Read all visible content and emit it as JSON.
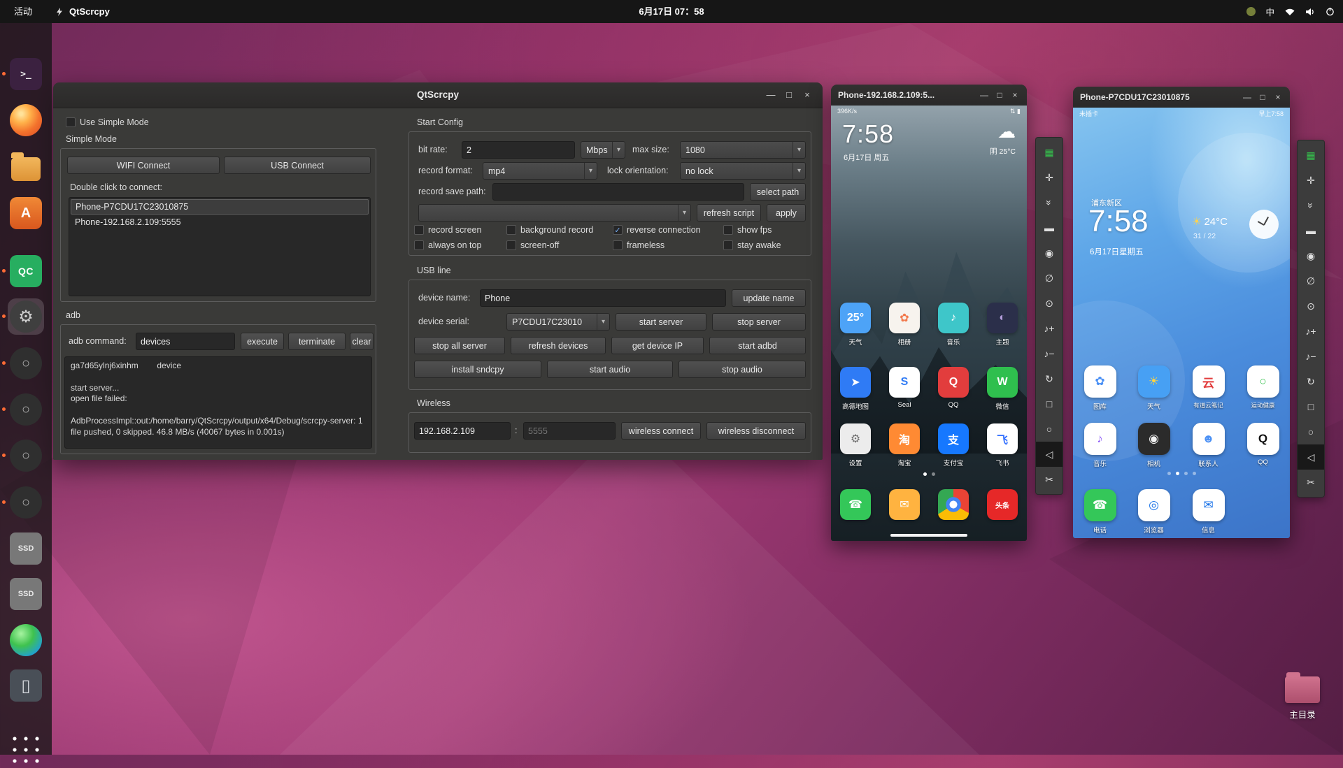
{
  "icons": {
    "chevron_down": "▾",
    "check": "✓"
  },
  "topbar": {
    "activities": "活动",
    "app_name": "QtScrcpy",
    "clock": "6月17日 07：58",
    "input_method": "中"
  },
  "dock": {
    "items": [
      {
        "name": "terminal",
        "glyph": ">_"
      },
      {
        "name": "firefox",
        "glyph": ""
      },
      {
        "name": "files",
        "glyph": ""
      },
      {
        "name": "ubuntu-software",
        "glyph": "A"
      },
      {
        "name": "qt-creator",
        "glyph": "QC"
      },
      {
        "name": "settings",
        "glyph": "⚙"
      },
      {
        "name": "phone-device-1",
        "glyph": "○"
      },
      {
        "name": "phone-device-2",
        "glyph": "○"
      },
      {
        "name": "phone-device-3",
        "glyph": "○"
      },
      {
        "name": "phone-device-4",
        "glyph": "○"
      },
      {
        "name": "ssd-1",
        "glyph": "SSD"
      },
      {
        "name": "ssd-2",
        "glyph": "SSD"
      },
      {
        "name": "disk-analyzer",
        "glyph": ""
      },
      {
        "name": "tablet-device",
        "glyph": ""
      },
      {
        "name": "show-applications",
        "glyph": ""
      }
    ]
  },
  "window": {
    "title": "QtScrcpy",
    "controls": {
      "minimize": "—",
      "maximize": "□",
      "close": "×"
    },
    "left": {
      "use_simple_mode": "Use Simple Mode",
      "simple_mode_group": "Simple Mode",
      "wifi_connect": "WIFI Connect",
      "usb_connect": "USB Connect",
      "double_click_hint": "Double click to connect:",
      "devices": [
        "Phone-P7CDU17C23010875",
        "Phone-192.168.2.109:5555"
      ],
      "adb_group": "adb",
      "adb_command_label": "adb command:",
      "adb_command_value": "devices",
      "execute": "execute",
      "terminate": "terminate",
      "clear": "clear",
      "log": "ga7d65ylnj6xinhm        device\n\nstart server...\nopen file failed:\n\nAdbProcessImpl::out:/home/barry/QtScrcpy/output/x64/Debug/scrcpy-server: 1 file pushed, 0 skipped. 46.8 MB/s (40067 bytes in 0.001s)"
    },
    "config": {
      "group": "Start Config",
      "bit_rate_label": "bit rate:",
      "bit_rate_value": "2",
      "bit_rate_unit": "Mbps",
      "max_size_label": "max size:",
      "max_size_value": "1080",
      "record_format_label": "record format:",
      "record_format_value": "mp4",
      "lock_orientation_label": "lock orientation:",
      "lock_orientation_value": "no lock",
      "record_save_path_label": "record save path:",
      "record_save_path_value": "",
      "select_path": "select path",
      "script_selector_value": "",
      "refresh_script": "refresh script",
      "apply": "apply",
      "record_screen": "record screen",
      "background_record": "background record",
      "reverse_connection": "reverse connection",
      "show_fps": "show fps",
      "always_on_top": "always on top",
      "screen_off": "screen-off",
      "frameless": "frameless",
      "stay_awake": "stay awake"
    },
    "usb": {
      "group": "USB line",
      "device_name_label": "device name:",
      "device_name_value": "Phone",
      "update_name": "update name",
      "device_serial_label": "device serial:",
      "device_serial_value": "P7CDU17C23010",
      "start_server": "start server",
      "stop_server": "stop server",
      "stop_all_server": "stop all server",
      "refresh_devices": "refresh devices",
      "get_device_ip": "get device IP",
      "start_adbd": "start adbd",
      "install_sndcpy": "install sndcpy",
      "start_audio": "start audio",
      "stop_audio": "stop audio"
    },
    "wireless": {
      "group": "Wireless",
      "ip_value": "192.168.2.109",
      "separator": ":",
      "port_placeholder": "5555",
      "wireless_connect": "wireless connect",
      "wireless_disconnect": "wireless disconnect"
    }
  },
  "phone1": {
    "title": "Phone-192.168.2.109:5...",
    "status_left": "396K/s",
    "status_right": "⇅ ▮",
    "clock": "7:58",
    "date": "6月17日 周五",
    "weather_icon": "☁",
    "weather": "阴 25°C",
    "row1": [
      {
        "label": "天气",
        "glyph": "25°",
        "bg": "#4da3f7",
        "fg": "#ffffff"
      },
      {
        "label": "相册",
        "glyph": "✿",
        "bg": "#f7f3ee",
        "fg": "#f2784b"
      },
      {
        "label": "音乐",
        "glyph": "♪",
        "bg": "#3ec6c9",
        "fg": "#ffffff"
      },
      {
        "label": "主题",
        "glyph": "◐",
        "bg": "#2b2f4a",
        "fg": "#b39ddb"
      }
    ],
    "row2": [
      {
        "label": "高德地图",
        "glyph": "➤",
        "bg": "#2f7bf5",
        "fg": "#ffffff"
      },
      {
        "label": "Seal",
        "glyph": "S",
        "bg": "#ffffff",
        "fg": "#2f7bf5"
      },
      {
        "label": "QQ",
        "glyph": "Q",
        "bg": "#e23d3d",
        "fg": "#ffffff"
      },
      {
        "label": "微信",
        "glyph": "W",
        "bg": "#2fbf4e",
        "fg": "#ffffff"
      }
    ],
    "row3": [
      {
        "label": "设置",
        "glyph": "⚙",
        "bg": "#ececec",
        "fg": "#6f6f6f"
      },
      {
        "label": "淘宝",
        "glyph": "淘",
        "bg": "#ff8a33",
        "fg": "#ffffff"
      },
      {
        "label": "支付宝",
        "glyph": "支",
        "bg": "#1678ff",
        "fg": "#ffffff"
      },
      {
        "label": "飞书",
        "glyph": "飞",
        "bg": "#ffffff",
        "fg": "#3370ff"
      }
    ],
    "dock": [
      {
        "label": "电话",
        "glyph": "☎",
        "bg": "#34c759",
        "fg": "#ffffff"
      },
      {
        "label": "短信",
        "glyph": "✉",
        "bg": "#ffb340",
        "fg": "#ffffff"
      },
      {
        "label": "浏览器",
        "glyph": "",
        "bg": "radial-gradient(circle at 50% 50%, #ffffff 17%, #4285f4 18% 34%, rgba(0,0,0,0) 35%), conic-gradient(#ea4335 0 33%, #fbbc05 0 66%, #34a853 0 100%)",
        "fg": "#ffffff"
      },
      {
        "label": "头条",
        "glyph": "头条",
        "bg": "#e62828",
        "fg": "#ffffff"
      }
    ]
  },
  "phone2": {
    "title": "Phone-P7CDU17C23010875",
    "status_left": "未插卡",
    "status_right": "早上7:58",
    "location": "浦东新区",
    "clock": "7:58",
    "date": "6月17日星期五",
    "weather_icon": "☀",
    "temp": "24°C",
    "hi_lo": "31 / 22",
    "row1": [
      {
        "label": "图库",
        "glyph": "✿",
        "bg": "#ffffff",
        "fg": "#4a90f5"
      },
      {
        "label": "天气",
        "glyph": "☀",
        "bg": "#47a0f4",
        "fg": "#ffd343"
      },
      {
        "label": "有道云笔记",
        "glyph": "云",
        "bg": "#ffffff",
        "fg": "#e23d3d"
      },
      {
        "label": "运动健康",
        "glyph": "○",
        "bg": "#ffffff",
        "fg": "#35c24d"
      }
    ],
    "row2": [
      {
        "label": "音乐",
        "glyph": "♪",
        "bg": "#ffffff",
        "fg": "#8e5cf7"
      },
      {
        "label": "相机",
        "glyph": "◉",
        "bg": "#2b2b2b",
        "fg": "#f2f2f2"
      },
      {
        "label": "联系人",
        "glyph": "☻",
        "bg": "#ffffff",
        "fg": "#4a90f5"
      },
      {
        "label": "QQ",
        "glyph": "Q",
        "bg": "#ffffff",
        "fg": "#111111"
      }
    ],
    "dock": [
      {
        "label": "电话",
        "glyph": "☎",
        "bg": "#34c759",
        "fg": "#ffffff"
      },
      {
        "label": "浏览器",
        "glyph": "◎",
        "bg": "#ffffff",
        "fg": "#1a73e8"
      },
      {
        "label": "信息",
        "glyph": "✉",
        "bg": "#ffffff",
        "fg": "#1a73e8"
      }
    ]
  },
  "toolbar": {
    "items": [
      {
        "name": "group-control",
        "glyph": "▦"
      },
      {
        "name": "fullscreen",
        "glyph": "✛"
      },
      {
        "name": "hide-panel",
        "glyph": "»"
      },
      {
        "name": "touch",
        "glyph": "▬"
      },
      {
        "name": "screen-on",
        "glyph": "◉"
      },
      {
        "name": "screen-off",
        "glyph": "∅"
      },
      {
        "name": "power",
        "glyph": "⊙"
      },
      {
        "name": "volume-up",
        "glyph": "♪+"
      },
      {
        "name": "volume-down",
        "glyph": "♪−"
      },
      {
        "name": "rotate",
        "glyph": "↻"
      },
      {
        "name": "app-switch",
        "glyph": "□"
      },
      {
        "name": "home",
        "glyph": "○"
      },
      {
        "name": "back",
        "glyph": "◁"
      },
      {
        "name": "screenshot",
        "glyph": "✂"
      }
    ]
  },
  "desktop": {
    "home_label": "主目录"
  }
}
